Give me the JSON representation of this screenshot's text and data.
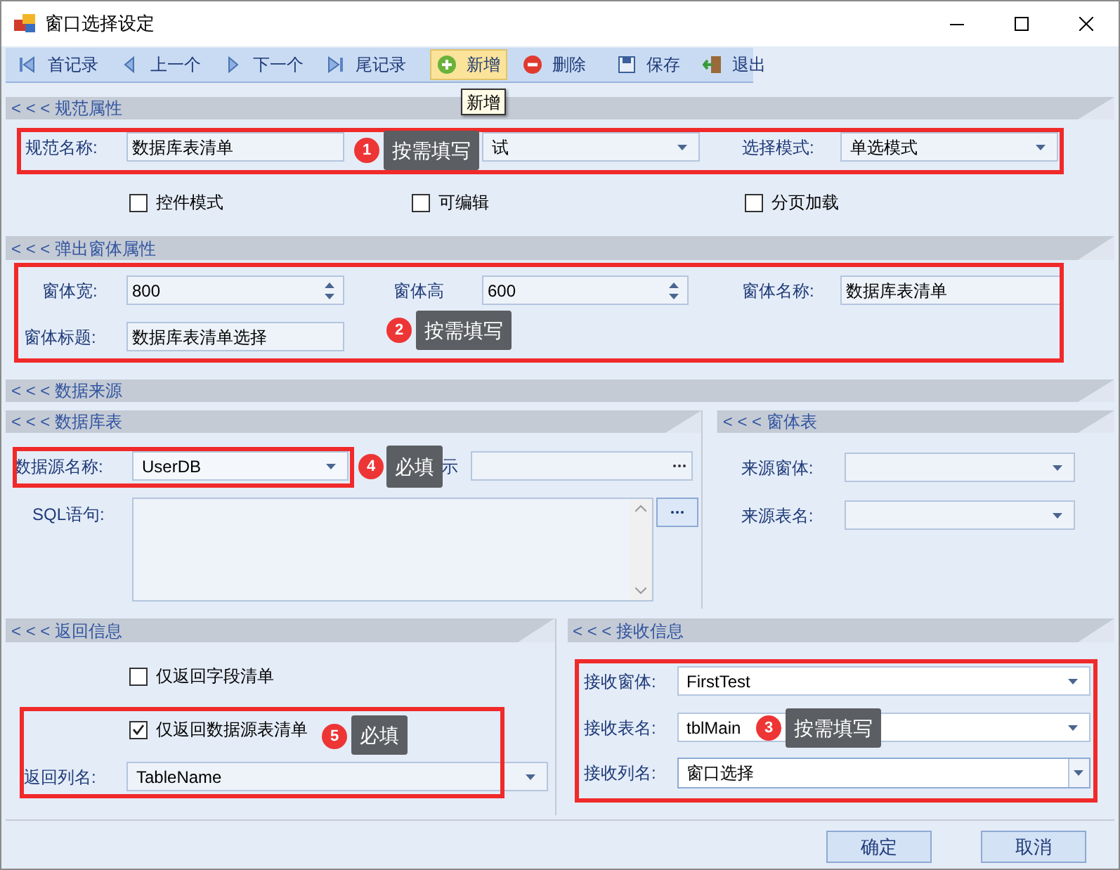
{
  "window": {
    "title": "窗口选择设定"
  },
  "toolbar": [
    {
      "kind": "first",
      "label": "首记录",
      "highlighted": false
    },
    {
      "kind": "prev",
      "label": "上一个",
      "highlighted": false
    },
    {
      "kind": "next",
      "label": "下一个",
      "highlighted": false
    },
    {
      "kind": "last",
      "label": "尾记录",
      "highlighted": false
    },
    {
      "kind": "add",
      "label": "新增",
      "highlighted": true
    },
    {
      "kind": "delete",
      "label": "删除",
      "highlighted": false
    },
    {
      "kind": "save",
      "label": "保存",
      "highlighted": false
    },
    {
      "kind": "exit",
      "label": "退出",
      "highlighted": false
    }
  ],
  "tooltip": "新增",
  "spec": {
    "header": "< < < 规范属性",
    "name": {
      "label": "规范名称:",
      "value": "数据库表清单"
    },
    "combo": {
      "value": "试"
    },
    "mode": {
      "label": "选择模式:",
      "value": "单选模式"
    },
    "options": [
      {
        "label": "控件模式",
        "checked": false
      },
      {
        "label": "可编辑",
        "checked": false
      },
      {
        "label": "分页加载",
        "checked": false
      }
    ]
  },
  "popup": {
    "header": "< < < 弹出窗体属性",
    "width": {
      "label": "窗体宽:",
      "value": "800"
    },
    "height": {
      "label": "窗体高",
      "value": "600"
    },
    "form_name": {
      "label": "窗体名称:",
      "value": "数据库表清单"
    },
    "form_title": {
      "label": "窗体标题:",
      "value": "数据库表清单选择"
    }
  },
  "data_source": {
    "header": "< < < 数据来源",
    "database": {
      "header": "< < < 数据库表",
      "source": {
        "label": "数据源名称:",
        "value": "UserDB"
      },
      "covered_field": {
        "label": "示"
      },
      "sql": {
        "label": "SQL语句:"
      }
    },
    "form_table": {
      "header": "< < < 窗体表",
      "source_form": {
        "label": "来源窗体:"
      },
      "source_table": {
        "label": "来源表名:"
      }
    }
  },
  "return_info": {
    "header": "< < < 返回信息",
    "options": [
      {
        "label": "仅返回字段清单",
        "checked": false
      },
      {
        "label": "仅返回数据源表清单",
        "checked": true
      }
    ],
    "column": {
      "label": "返回列名:",
      "value": "TableName"
    }
  },
  "receive_info": {
    "header": "< < < 接收信息",
    "form": {
      "label": "接收窗体:",
      "value": "FirstTest"
    },
    "table": {
      "label": "接收表名:",
      "value": "tblMain"
    },
    "column": {
      "label": "接收列名:",
      "value": "窗口选择"
    }
  },
  "annotations": [
    {
      "number": "1",
      "text": "按需填写"
    },
    {
      "number": "2",
      "text": "按需填写"
    },
    {
      "number": "4",
      "text": "必填"
    },
    {
      "number": "5",
      "text": "必填"
    },
    {
      "number": "3",
      "text": "按需填写"
    }
  ],
  "buttons": [
    {
      "label": "确定"
    },
    {
      "label": "取消"
    }
  ]
}
